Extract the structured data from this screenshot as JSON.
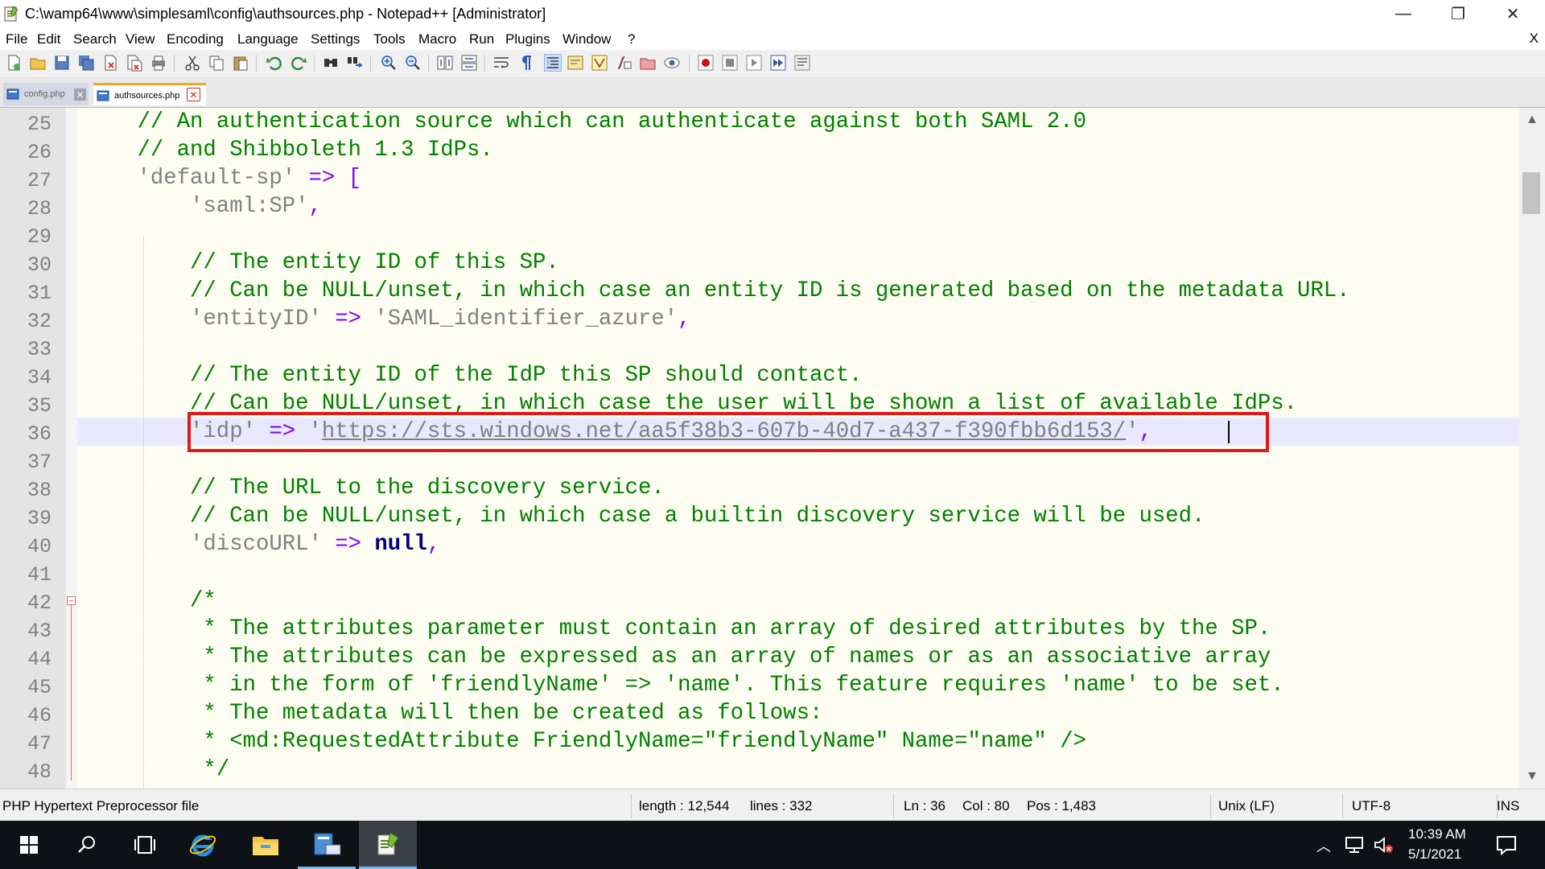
{
  "window": {
    "title": "C:\\wamp64\\www\\simplesaml\\config\\authsources.php - Notepad++ [Administrator]",
    "minimize_glyph": "—",
    "restore_glyph": "❐",
    "close_glyph": "✕"
  },
  "menu": {
    "items": [
      "File",
      "Edit",
      "Search",
      "View",
      "Encoding",
      "Language",
      "Settings",
      "Tools",
      "Macro",
      "Run",
      "Plugins",
      "Window",
      "?"
    ],
    "close_label": "X"
  },
  "tabs": [
    {
      "label": "config.php",
      "active": false
    },
    {
      "label": "authsources.php",
      "active": true
    }
  ],
  "editor": {
    "line_numbers": [
      "25",
      "26",
      "27",
      "28",
      "29",
      "30",
      "31",
      "32",
      "33",
      "34",
      "35",
      "36",
      "37",
      "38",
      "39",
      "40",
      "41",
      "42",
      "43",
      "44",
      "45",
      "46",
      "47",
      "48"
    ],
    "lines": {
      "l25": "// An authentication source which can authenticate against both SAML 2.0",
      "l26": "// and Shibboleth 1.3 IdPs.",
      "l27a": "'default-sp'",
      "l27b": " => [",
      "l28a": "'saml:SP'",
      "l28b": ",",
      "l30": "// The entity ID of this SP.",
      "l31": "// Can be NULL/unset, in which case an entity ID is generated based on the metadata URL.",
      "l32a": "'entityID'",
      "l32b": " => ",
      "l32c": "'SAML_identifier_azure'",
      "l32d": ",",
      "l34": "// The entity ID of the IdP this SP should contact.",
      "l35": "// Can be NULL/unset, in which case the user will be shown a list of available IdPs.",
      "l36a": "'idp'",
      "l36b": " => ",
      "l36c": "'",
      "l36d": "https://sts.windows.net/aa5f38b3-607b-40d7-a437-f390fbb6d153/",
      "l36e": "'",
      "l36f": ",",
      "l38": "// The URL to the discovery service.",
      "l39": "// Can be NULL/unset, in which case a builtin discovery service will be used.",
      "l40a": "'discoURL'",
      "l40b": " => ",
      "l40c": "null",
      "l40d": ",",
      "l42": "/*",
      "l43": " * The attributes parameter must contain an array of desired attributes by the SP.",
      "l44": " * The attributes can be expressed as an array of names or as an associative array",
      "l45": " * in the form of 'friendlyName' => 'name'. This feature requires 'name' to be set.",
      "l46": " * The metadata will then be created as follows:",
      "l47": " * <md:RequestedAttribute FriendlyName=\"friendlyName\" Name=\"name\" />",
      "l48": " */"
    }
  },
  "statusbar": {
    "file_type": "PHP Hypertext Preprocessor file",
    "length": "length : 12,544",
    "lines": "lines : 332",
    "ln": "Ln : 36",
    "col": "Col : 80",
    "pos": "Pos : 1,483",
    "eol": "Unix (LF)",
    "encoding": "UTF-8",
    "mode": "INS"
  },
  "taskbar": {
    "time": "10:39 AM",
    "date": "5/1/2021",
    "apps": [
      "start-icon",
      "search-icon",
      "task-view-icon",
      "internet-explorer-icon",
      "file-explorer-icon",
      "server-manager-icon",
      "notepad-plus-plus-icon"
    ]
  },
  "colors": {
    "comment": "#008000",
    "string": "#808080",
    "operator": "#8000ff",
    "keyword": "#000080",
    "highlight_box": "#e01818",
    "current_line": "#e8e8ff"
  }
}
